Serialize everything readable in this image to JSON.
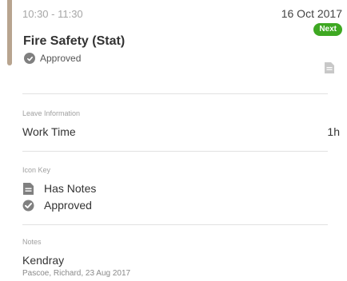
{
  "colors": {
    "accent_bar": "#b8a48f",
    "next_badge": "#3ea822",
    "icon_gray": "#808080"
  },
  "event": {
    "time_range": "10:30 - 11:30",
    "date": "16 Oct 2017",
    "badge": "Next",
    "title": "Fire Safety (Stat)",
    "status": "Approved",
    "status_icon": "check-circle-icon",
    "notes_icon": "document-icon"
  },
  "leave_information": {
    "heading": "Leave Information",
    "rows": [
      {
        "label": "Work Time",
        "value": "1h"
      }
    ]
  },
  "icon_key": {
    "heading": "Icon Key",
    "items": [
      {
        "icon": "document-icon",
        "label": "Has Notes"
      },
      {
        "icon": "check-circle-icon",
        "label": "Approved"
      }
    ]
  },
  "notes": {
    "heading": "Notes",
    "items": [
      {
        "author": "Kendray",
        "meta": "Pascoe, Richard, 23 Aug 2017"
      }
    ]
  }
}
